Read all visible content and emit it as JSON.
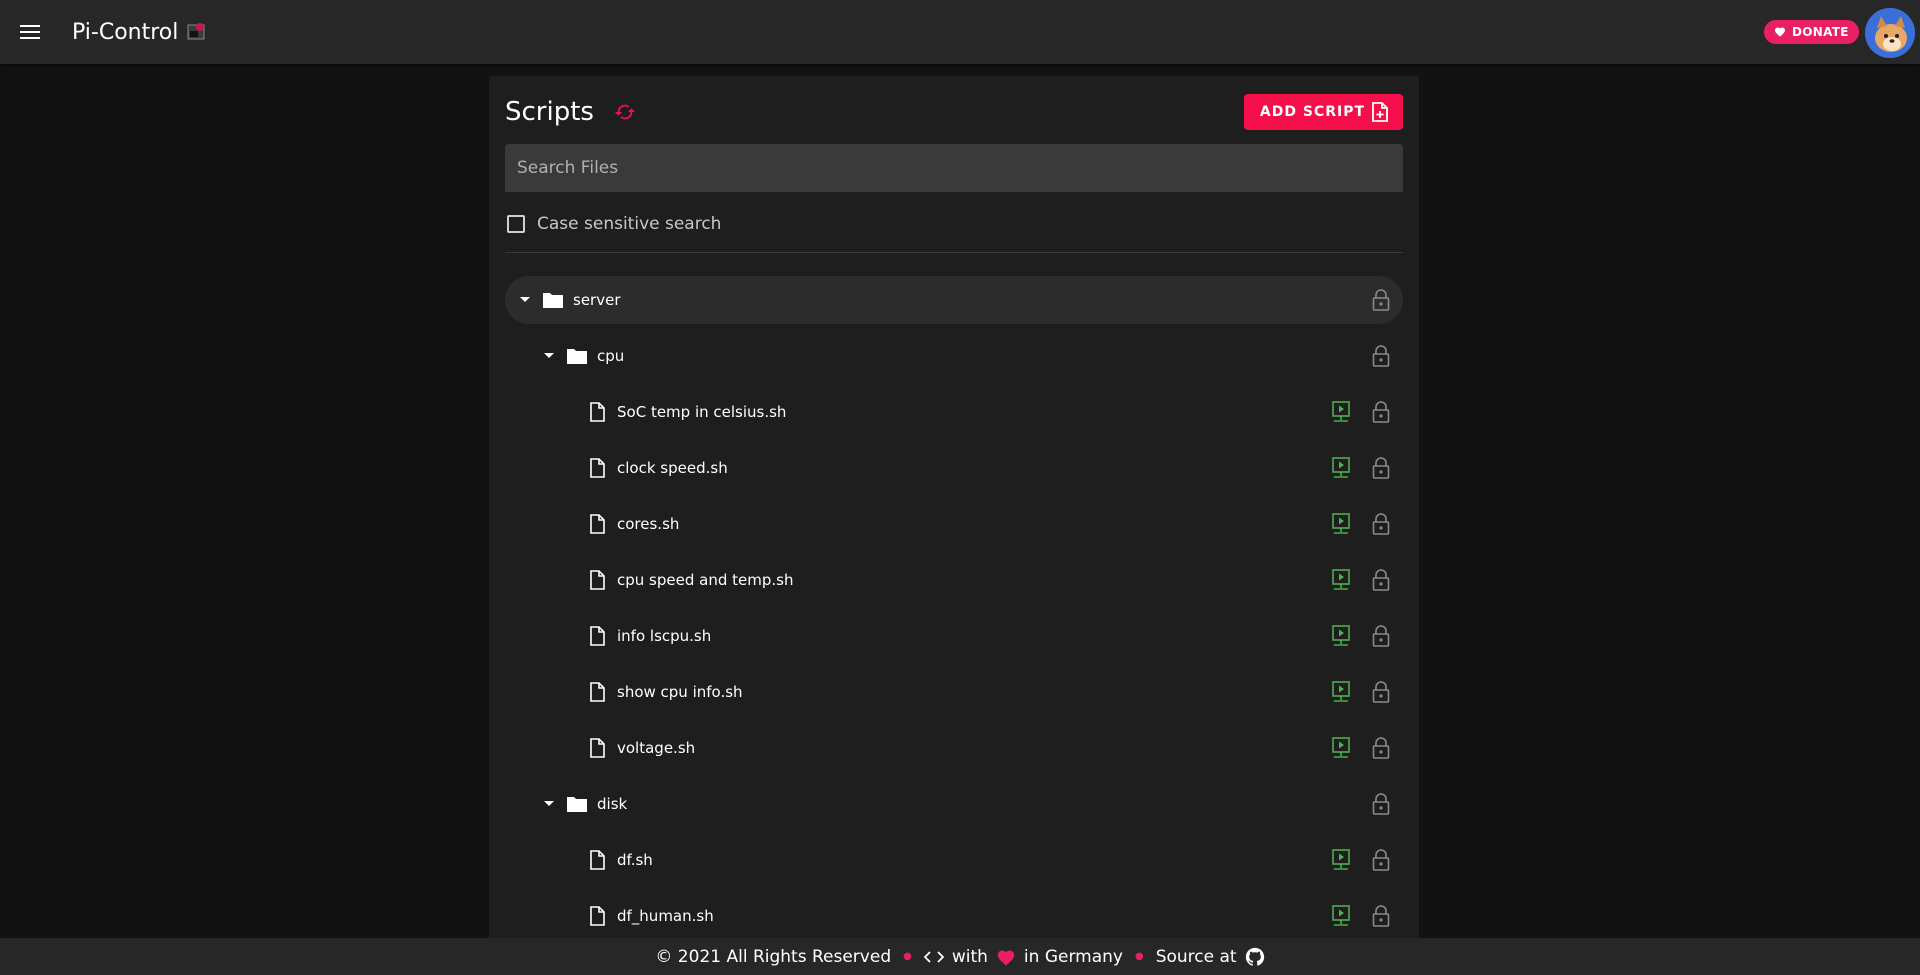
{
  "app": {
    "title": "Pi-Control",
    "donate_label": "DONATE"
  },
  "scripts": {
    "title": "Scripts",
    "add_button_label": "ADD SCRIPT",
    "search_placeholder": "Search Files",
    "search_value": "",
    "case_sensitive_label": "Case sensitive search",
    "case_sensitive_checked": false
  },
  "tree": {
    "root": {
      "label": "server",
      "expanded": true
    },
    "folders": [
      {
        "label": "cpu",
        "expanded": true,
        "files": [
          "SoC temp in celsius.sh",
          "clock speed.sh",
          "cores.sh",
          "cpu speed and temp.sh",
          "info lscpu.sh",
          "show cpu info.sh",
          "voltage.sh"
        ]
      },
      {
        "label": "disk",
        "expanded": true,
        "files": [
          "df.sh",
          "df_human.sh"
        ]
      }
    ]
  },
  "footer": {
    "copyright": "© 2021 All Rights Reserved",
    "with_text": "with",
    "in_text": "in Germany",
    "source_text": "Source at"
  },
  "colors": {
    "accent": "#f50f4a",
    "run_green": "#4caf50",
    "lock_gray": "#8a8a8a",
    "background": "#121212",
    "card": "#1e1e1e"
  }
}
